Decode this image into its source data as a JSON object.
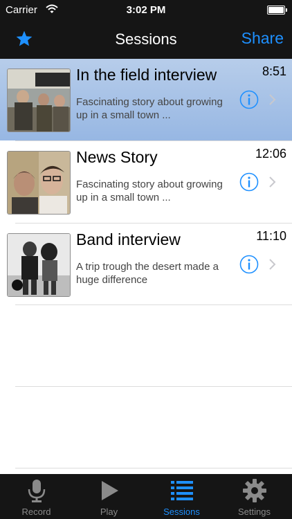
{
  "status_bar": {
    "carrier": "Carrier",
    "time": "3:02 PM"
  },
  "nav": {
    "title": "Sessions",
    "share_label": "Share",
    "left_icon": "star-icon"
  },
  "sessions": [
    {
      "title": "In the field interview",
      "duration": "8:51",
      "description": "Fascinating story about growing up in a small town ...",
      "selected": true
    },
    {
      "title": "News Story",
      "duration": "12:06",
      "description": "Fascinating story about growing up in a small town ...",
      "selected": false
    },
    {
      "title": "Band interview",
      "duration": "11:10",
      "description": "A trip trough the desert made a huge difference",
      "selected": false
    }
  ],
  "tabs": [
    {
      "label": "Record",
      "icon": "microphone-icon",
      "active": false
    },
    {
      "label": "Play",
      "icon": "play-icon",
      "active": false
    },
    {
      "label": "Sessions",
      "icon": "list-icon",
      "active": true
    },
    {
      "label": "Settings",
      "icon": "gear-icon",
      "active": false
    }
  ],
  "colors": {
    "accent": "#1e90ff",
    "bar_bg": "#151515",
    "selected_row": "#a8c3e8"
  }
}
